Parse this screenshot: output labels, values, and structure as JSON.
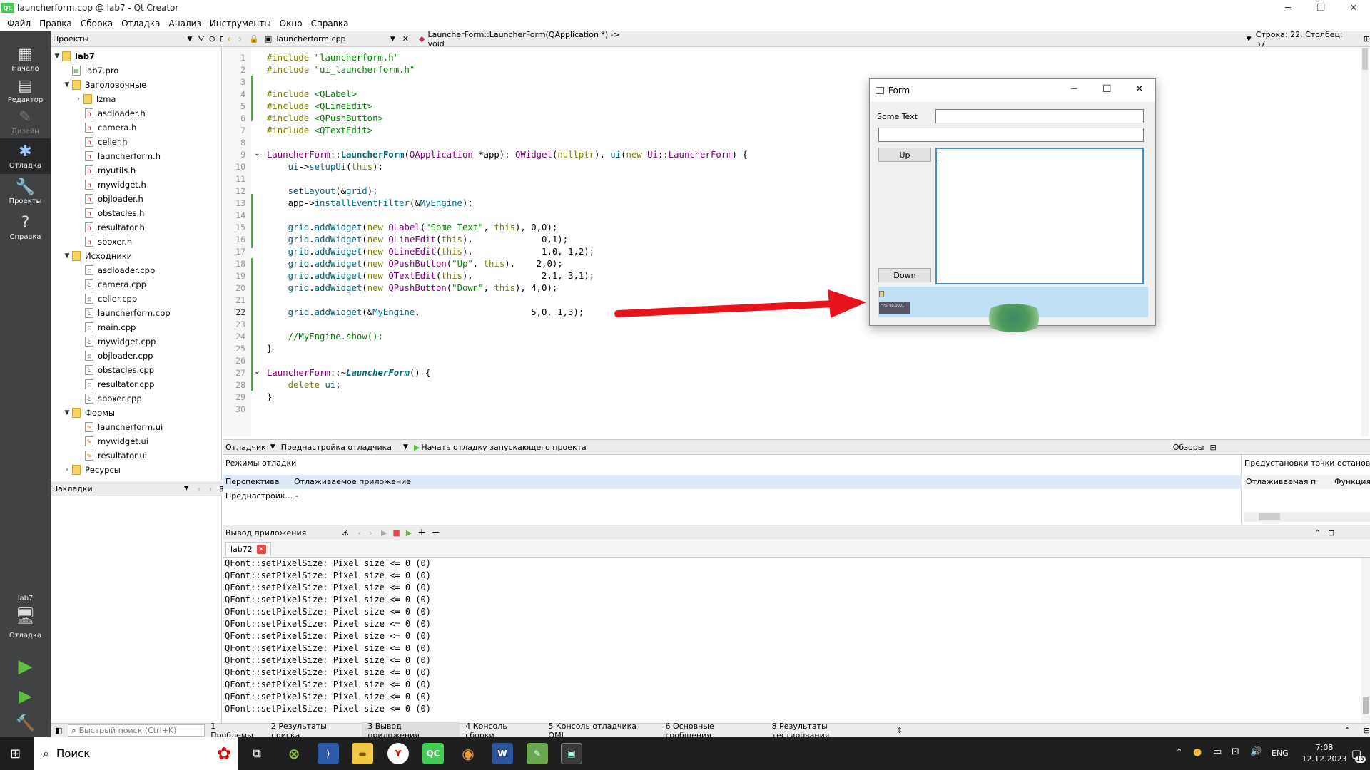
{
  "window": {
    "title": "launcherform.cpp @ lab7 - Qt Creator",
    "app_icon": "QC"
  },
  "menu": [
    "Файл",
    "Правка",
    "Сборка",
    "Отладка",
    "Анализ",
    "Инструменты",
    "Окно",
    "Справка"
  ],
  "modes": [
    {
      "label": "Начало",
      "icon": "grid-icon"
    },
    {
      "label": "Редактор",
      "icon": "editor-icon"
    },
    {
      "label": "Дизайн",
      "icon": "design-icon"
    },
    {
      "label": "Отладка",
      "icon": "bug-icon"
    },
    {
      "label": "Проекты",
      "icon": "wrench-icon"
    },
    {
      "label": "Справка",
      "icon": "help-icon"
    }
  ],
  "kit": {
    "project": "lab7",
    "mode": "Отладка"
  },
  "projects_pane": {
    "title": "Проекты"
  },
  "tree": {
    "root": "lab7",
    "pro": "lab7.pro",
    "headers_label": "Заголовочные",
    "lzma": "lzma",
    "headers": [
      "asdloader.h",
      "camera.h",
      "celler.h",
      "launcherform.h",
      "myutils.h",
      "mywidget.h",
      "objloader.h",
      "obstacles.h",
      "resultator.h",
      "sboxer.h"
    ],
    "sources_label": "Исходники",
    "sources": [
      "asdloader.cpp",
      "camera.cpp",
      "celler.cpp",
      "launcherform.cpp",
      "main.cpp",
      "mywidget.cpp",
      "objloader.cpp",
      "obstacles.cpp",
      "resultator.cpp",
      "sboxer.cpp"
    ],
    "forms_label": "Формы",
    "forms": [
      "launcherform.ui",
      "mywidget.ui",
      "resultator.ui"
    ],
    "resources_label": "Ресурсы"
  },
  "bookmarks": {
    "title": "Закладки"
  },
  "editor": {
    "file": "launcherform.cpp",
    "symbol": "LauncherForm::LauncherForm(QApplication *) -> void",
    "position": "Строка: 22, Столбец: 57",
    "line_numbers": [
      "1",
      "2",
      "3",
      "4",
      "5",
      "6",
      "7",
      "8",
      "9",
      "10",
      "11",
      "12",
      "13",
      "14",
      "15",
      "16",
      "17",
      "18",
      "19",
      "20",
      "21",
      "22",
      "23",
      "24",
      "25",
      "26",
      "27",
      "28",
      "29",
      "30"
    ]
  },
  "form": {
    "title": "Form",
    "label": "Some Text",
    "up_button": "Up",
    "down_button": "Down",
    "fps": "FPS: 60.0001"
  },
  "debug": {
    "toolbar": {
      "debugger": "Отладчик",
      "preset": "Преднастройка отладчика",
      "start": "Начать отладку запускающего проекта",
      "views": "Обзоры"
    },
    "modes_title": "Режимы отладки",
    "perspective_label": "Перспектива",
    "perspective_value": "Отлаживаемое приложение",
    "presets_label": "Преднастройк...",
    "presets_value": "-",
    "breakpoints_title": "Предустановки точки остановки",
    "col1": "Отлаживаемая п",
    "col2": "Функция"
  },
  "output": {
    "title": "Вывод приложения",
    "tab": "lab72",
    "lines": [
      "QFont::setPixelSize: Pixel size <= 0 (0)",
      "QFont::setPixelSize: Pixel size <= 0 (0)",
      "QFont::setPixelSize: Pixel size <= 0 (0)",
      "QFont::setPixelSize: Pixel size <= 0 (0)",
      "QFont::setPixelSize: Pixel size <= 0 (0)",
      "QFont::setPixelSize: Pixel size <= 0 (0)",
      "QFont::setPixelSize: Pixel size <= 0 (0)",
      "QFont::setPixelSize: Pixel size <= 0 (0)",
      "QFont::setPixelSize: Pixel size <= 0 (0)",
      "QFont::setPixelSize: Pixel size <= 0 (0)",
      "QFont::setPixelSize: Pixel size <= 0 (0)",
      "QFont::setPixelSize: Pixel size <= 0 (0)",
      "QFont::setPixelSize: Pixel size <= 0 (0)"
    ]
  },
  "statusbar": {
    "search_placeholder": "Быстрый поиск (Ctrl+K)",
    "panes": [
      "1 Проблемы",
      "2 Результаты поиска",
      "3 Вывод приложения",
      "4 Консоль сборки",
      "5 Консоль отладчика QML",
      "6 Основные сообщения",
      "8 Результаты тестирования"
    ]
  },
  "taskbar": {
    "search": "Поиск",
    "lang": "ENG",
    "time": "7:08",
    "date": "12.12.2023",
    "notifications": "15"
  }
}
